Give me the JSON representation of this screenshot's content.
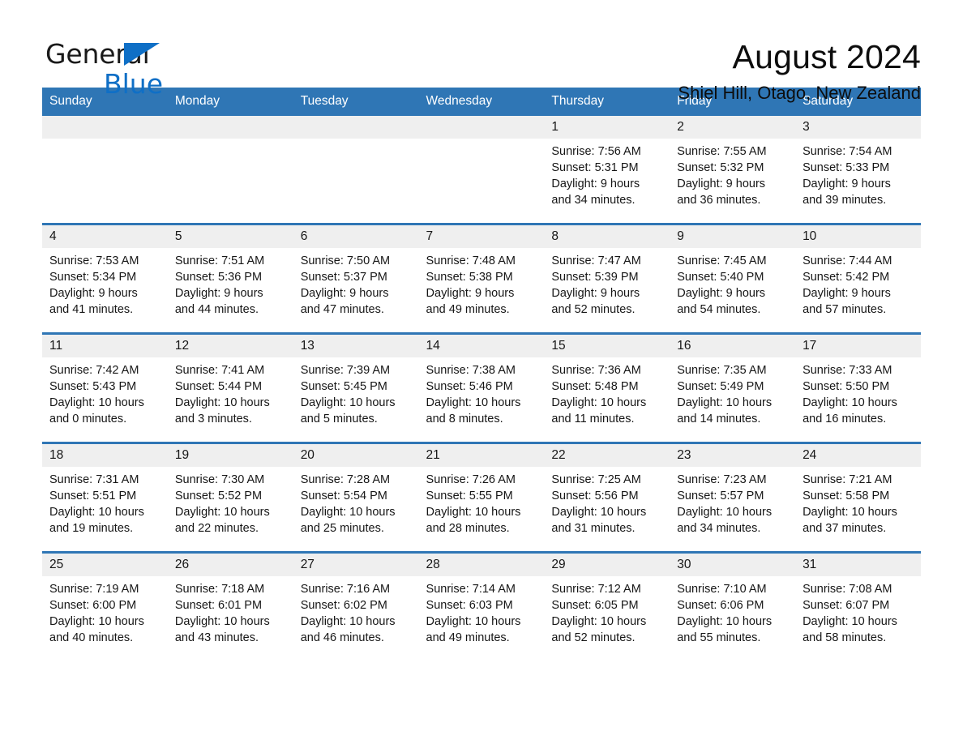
{
  "brand": {
    "name_part1": "General",
    "name_part2": "Blue",
    "triangle_color": "#0f6fc6"
  },
  "header": {
    "title": "August 2024",
    "location": "Shiel Hill, Otago, New Zealand"
  },
  "theme": {
    "header_blue": "#2f76b5",
    "daynum_band": "#efefef",
    "text": "#161616"
  },
  "calendar": {
    "weekday_headers": [
      "Sunday",
      "Monday",
      "Tuesday",
      "Wednesday",
      "Thursday",
      "Friday",
      "Saturday"
    ],
    "weeks": [
      [
        {
          "day": "",
          "empty": true
        },
        {
          "day": "",
          "empty": true
        },
        {
          "day": "",
          "empty": true
        },
        {
          "day": "",
          "empty": true
        },
        {
          "day": "1",
          "sunrise": "Sunrise: 7:56 AM",
          "sunset": "Sunset: 5:31 PM",
          "daylight1": "Daylight: 9 hours",
          "daylight2": "and 34 minutes."
        },
        {
          "day": "2",
          "sunrise": "Sunrise: 7:55 AM",
          "sunset": "Sunset: 5:32 PM",
          "daylight1": "Daylight: 9 hours",
          "daylight2": "and 36 minutes."
        },
        {
          "day": "3",
          "sunrise": "Sunrise: 7:54 AM",
          "sunset": "Sunset: 5:33 PM",
          "daylight1": "Daylight: 9 hours",
          "daylight2": "and 39 minutes."
        }
      ],
      [
        {
          "day": "4",
          "sunrise": "Sunrise: 7:53 AM",
          "sunset": "Sunset: 5:34 PM",
          "daylight1": "Daylight: 9 hours",
          "daylight2": "and 41 minutes."
        },
        {
          "day": "5",
          "sunrise": "Sunrise: 7:51 AM",
          "sunset": "Sunset: 5:36 PM",
          "daylight1": "Daylight: 9 hours",
          "daylight2": "and 44 minutes."
        },
        {
          "day": "6",
          "sunrise": "Sunrise: 7:50 AM",
          "sunset": "Sunset: 5:37 PM",
          "daylight1": "Daylight: 9 hours",
          "daylight2": "and 47 minutes."
        },
        {
          "day": "7",
          "sunrise": "Sunrise: 7:48 AM",
          "sunset": "Sunset: 5:38 PM",
          "daylight1": "Daylight: 9 hours",
          "daylight2": "and 49 minutes."
        },
        {
          "day": "8",
          "sunrise": "Sunrise: 7:47 AM",
          "sunset": "Sunset: 5:39 PM",
          "daylight1": "Daylight: 9 hours",
          "daylight2": "and 52 minutes."
        },
        {
          "day": "9",
          "sunrise": "Sunrise: 7:45 AM",
          "sunset": "Sunset: 5:40 PM",
          "daylight1": "Daylight: 9 hours",
          "daylight2": "and 54 minutes."
        },
        {
          "day": "10",
          "sunrise": "Sunrise: 7:44 AM",
          "sunset": "Sunset: 5:42 PM",
          "daylight1": "Daylight: 9 hours",
          "daylight2": "and 57 minutes."
        }
      ],
      [
        {
          "day": "11",
          "sunrise": "Sunrise: 7:42 AM",
          "sunset": "Sunset: 5:43 PM",
          "daylight1": "Daylight: 10 hours",
          "daylight2": "and 0 minutes."
        },
        {
          "day": "12",
          "sunrise": "Sunrise: 7:41 AM",
          "sunset": "Sunset: 5:44 PM",
          "daylight1": "Daylight: 10 hours",
          "daylight2": "and 3 minutes."
        },
        {
          "day": "13",
          "sunrise": "Sunrise: 7:39 AM",
          "sunset": "Sunset: 5:45 PM",
          "daylight1": "Daylight: 10 hours",
          "daylight2": "and 5 minutes."
        },
        {
          "day": "14",
          "sunrise": "Sunrise: 7:38 AM",
          "sunset": "Sunset: 5:46 PM",
          "daylight1": "Daylight: 10 hours",
          "daylight2": "and 8 minutes."
        },
        {
          "day": "15",
          "sunrise": "Sunrise: 7:36 AM",
          "sunset": "Sunset: 5:48 PM",
          "daylight1": "Daylight: 10 hours",
          "daylight2": "and 11 minutes."
        },
        {
          "day": "16",
          "sunrise": "Sunrise: 7:35 AM",
          "sunset": "Sunset: 5:49 PM",
          "daylight1": "Daylight: 10 hours",
          "daylight2": "and 14 minutes."
        },
        {
          "day": "17",
          "sunrise": "Sunrise: 7:33 AM",
          "sunset": "Sunset: 5:50 PM",
          "daylight1": "Daylight: 10 hours",
          "daylight2": "and 16 minutes."
        }
      ],
      [
        {
          "day": "18",
          "sunrise": "Sunrise: 7:31 AM",
          "sunset": "Sunset: 5:51 PM",
          "daylight1": "Daylight: 10 hours",
          "daylight2": "and 19 minutes."
        },
        {
          "day": "19",
          "sunrise": "Sunrise: 7:30 AM",
          "sunset": "Sunset: 5:52 PM",
          "daylight1": "Daylight: 10 hours",
          "daylight2": "and 22 minutes."
        },
        {
          "day": "20",
          "sunrise": "Sunrise: 7:28 AM",
          "sunset": "Sunset: 5:54 PM",
          "daylight1": "Daylight: 10 hours",
          "daylight2": "and 25 minutes."
        },
        {
          "day": "21",
          "sunrise": "Sunrise: 7:26 AM",
          "sunset": "Sunset: 5:55 PM",
          "daylight1": "Daylight: 10 hours",
          "daylight2": "and 28 minutes."
        },
        {
          "day": "22",
          "sunrise": "Sunrise: 7:25 AM",
          "sunset": "Sunset: 5:56 PM",
          "daylight1": "Daylight: 10 hours",
          "daylight2": "and 31 minutes."
        },
        {
          "day": "23",
          "sunrise": "Sunrise: 7:23 AM",
          "sunset": "Sunset: 5:57 PM",
          "daylight1": "Daylight: 10 hours",
          "daylight2": "and 34 minutes."
        },
        {
          "day": "24",
          "sunrise": "Sunrise: 7:21 AM",
          "sunset": "Sunset: 5:58 PM",
          "daylight1": "Daylight: 10 hours",
          "daylight2": "and 37 minutes."
        }
      ],
      [
        {
          "day": "25",
          "sunrise": "Sunrise: 7:19 AM",
          "sunset": "Sunset: 6:00 PM",
          "daylight1": "Daylight: 10 hours",
          "daylight2": "and 40 minutes."
        },
        {
          "day": "26",
          "sunrise": "Sunrise: 7:18 AM",
          "sunset": "Sunset: 6:01 PM",
          "daylight1": "Daylight: 10 hours",
          "daylight2": "and 43 minutes."
        },
        {
          "day": "27",
          "sunrise": "Sunrise: 7:16 AM",
          "sunset": "Sunset: 6:02 PM",
          "daylight1": "Daylight: 10 hours",
          "daylight2": "and 46 minutes."
        },
        {
          "day": "28",
          "sunrise": "Sunrise: 7:14 AM",
          "sunset": "Sunset: 6:03 PM",
          "daylight1": "Daylight: 10 hours",
          "daylight2": "and 49 minutes."
        },
        {
          "day": "29",
          "sunrise": "Sunrise: 7:12 AM",
          "sunset": "Sunset: 6:05 PM",
          "daylight1": "Daylight: 10 hours",
          "daylight2": "and 52 minutes."
        },
        {
          "day": "30",
          "sunrise": "Sunrise: 7:10 AM",
          "sunset": "Sunset: 6:06 PM",
          "daylight1": "Daylight: 10 hours",
          "daylight2": "and 55 minutes."
        },
        {
          "day": "31",
          "sunrise": "Sunrise: 7:08 AM",
          "sunset": "Sunset: 6:07 PM",
          "daylight1": "Daylight: 10 hours",
          "daylight2": "and 58 minutes."
        }
      ]
    ]
  }
}
